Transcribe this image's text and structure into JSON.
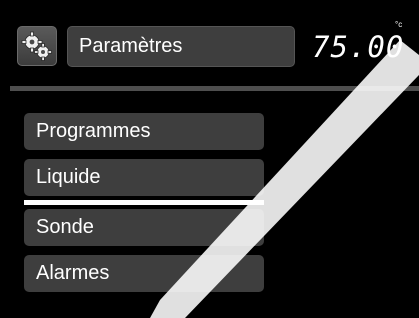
{
  "header": {
    "icon": "gears-icon",
    "title": "Paramètres",
    "temperature": "75.00",
    "temperature_unit": "°c"
  },
  "menu": {
    "items": [
      {
        "label": "Programmes",
        "selected": false
      },
      {
        "label": "Liquide",
        "selected": true
      },
      {
        "label": "Sonde",
        "selected": false
      },
      {
        "label": "Alarmes",
        "selected": false
      }
    ]
  },
  "colors": {
    "background": "#000000",
    "panel": "#3e3e3e",
    "separator": "#4e4e4e",
    "text": "#ffffff",
    "selection_underline": "#ffffff"
  }
}
